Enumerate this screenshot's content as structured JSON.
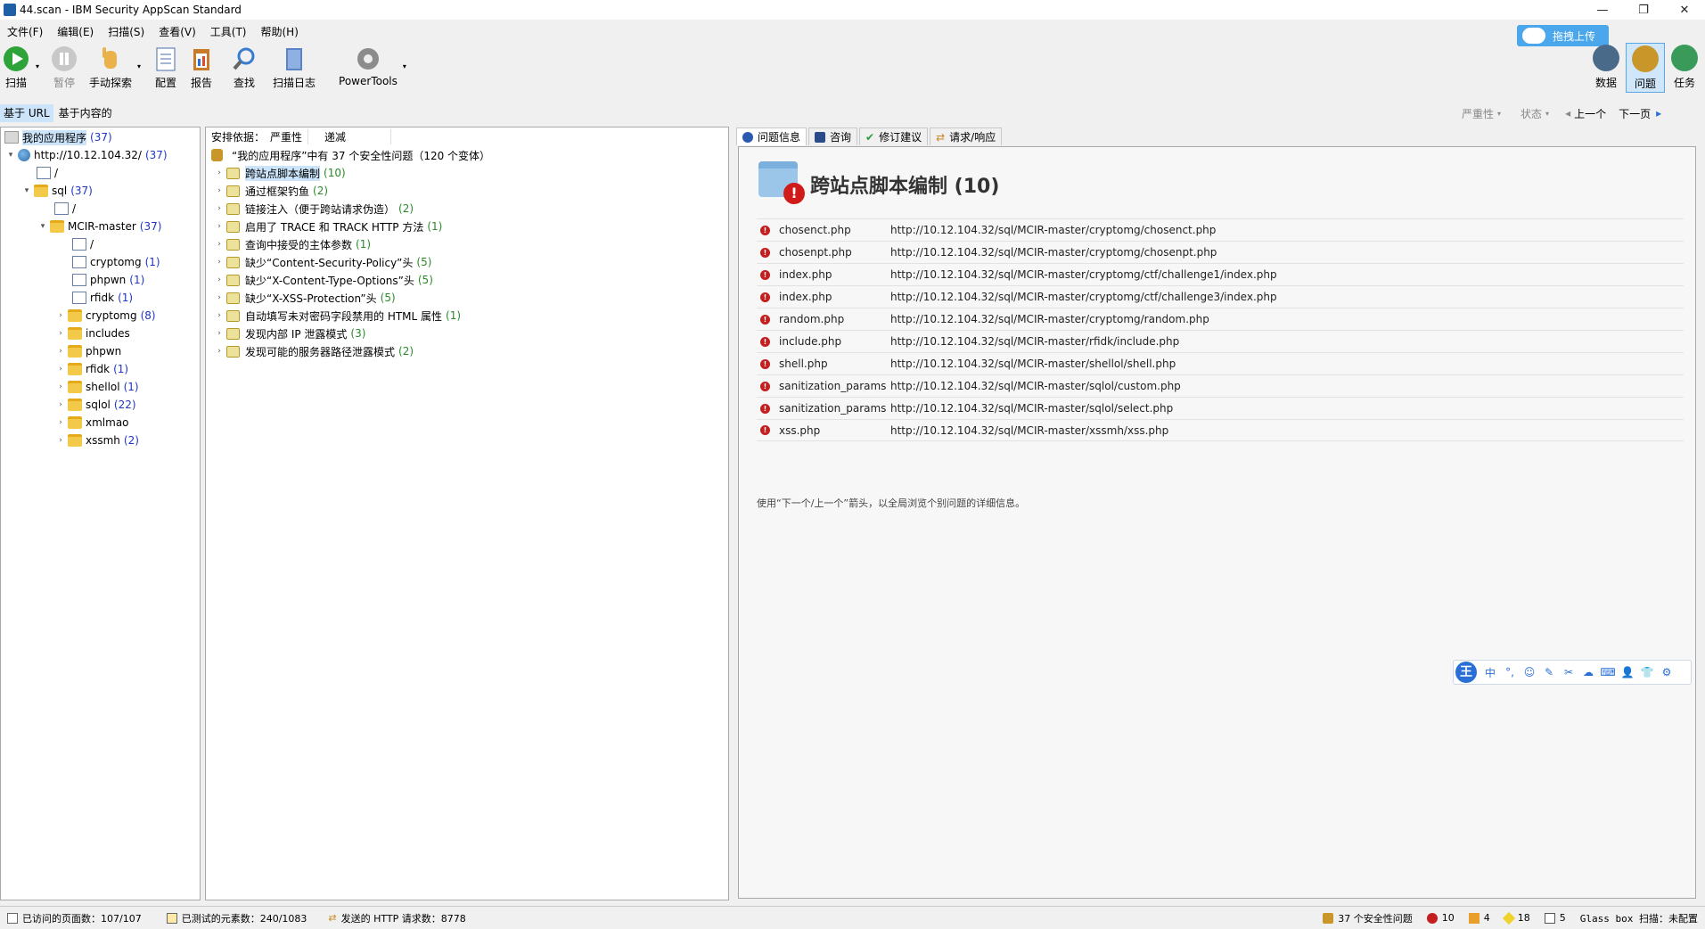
{
  "window": {
    "title": "44.scan - IBM Security AppScan Standard"
  },
  "menu": [
    "文件(F)",
    "编辑(E)",
    "扫描(S)",
    "查看(V)",
    "工具(T)",
    "帮助(H)"
  ],
  "upload": {
    "label": "拖拽上传"
  },
  "toolbar": {
    "scan": "扫描",
    "pause": "暂停",
    "manual": "手动探索",
    "config": "配置",
    "report": "报告",
    "find": "查找",
    "log": "扫描日志",
    "powertools": "PowerTools"
  },
  "toolbar_right": {
    "data": "数据",
    "issues": "问题",
    "tasks": "任务"
  },
  "view_tabs": {
    "by_url": "基于 URL",
    "by_content": "基于内容的"
  },
  "nav": {
    "severity": "严重性",
    "status": "状态",
    "prev": "上一个",
    "next": "下一页"
  },
  "tree": {
    "root": {
      "label": "我的应用程序",
      "count": "(37)"
    },
    "host": {
      "label": "http://10.12.104.32/",
      "count": "(37)"
    },
    "slash": "/",
    "sql": {
      "label": "sql",
      "count": "(37)"
    },
    "sql_slash": "/",
    "mcir": {
      "label": "MCIR-master",
      "count": "(37)"
    },
    "mcir_slash": "/",
    "cryptomg_page": {
      "label": "cryptomg",
      "count": "(1)"
    },
    "phpwn_page": {
      "label": "phpwn",
      "count": "(1)"
    },
    "rfidk_page": {
      "label": "rfidk",
      "count": "(1)"
    },
    "cryptomg": {
      "label": "cryptomg",
      "count": "(8)"
    },
    "includes": {
      "label": "includes"
    },
    "phpwn": {
      "label": "phpwn"
    },
    "rfidk": {
      "label": "rfidk",
      "count": "(1)"
    },
    "shellol": {
      "label": "shellol",
      "count": "(1)"
    },
    "sqlol": {
      "label": "sqlol",
      "count": "(22)"
    },
    "xmlmao": {
      "label": "xmlmao"
    },
    "xssmh": {
      "label": "xssmh",
      "count": "(2)"
    }
  },
  "mid": {
    "sort_label": "安排依据：",
    "sort_value": "严重性",
    "decrease": "递减",
    "summary": "“我的应用程序”中有 37 个安全性问题（120 个变体）",
    "issues": [
      {
        "label": "跨站点脚本编制",
        "count": "(10)"
      },
      {
        "label": "通过框架钓鱼",
        "count": "(2)"
      },
      {
        "label": "链接注入（便于跨站请求伪造）",
        "count": "(2)"
      },
      {
        "label": "启用了 TRACE 和 TRACK HTTP 方法",
        "count": "(1)"
      },
      {
        "label": "查询中接受的主体参数",
        "count": "(1)"
      },
      {
        "label": "缺少“Content-Security-Policy”头",
        "count": "(5)"
      },
      {
        "label": "缺少“X-Content-Type-Options”头",
        "count": "(5)"
      },
      {
        "label": "缺少“X-XSS-Protection”头",
        "count": "(5)"
      },
      {
        "label": "自动填写未对密码字段禁用的 HTML 属性",
        "count": "(1)"
      },
      {
        "label": "发现内部 IP 泄露模式",
        "count": "(3)"
      },
      {
        "label": "发现可能的服务器路径泄露模式",
        "count": "(2)"
      }
    ]
  },
  "right": {
    "tabs": [
      "问题信息",
      "咨询",
      "修订建议",
      "请求/响应"
    ],
    "title": "跨站点脚本编制 (10)",
    "rows": [
      {
        "file": "chosenct.php",
        "url": "http://10.12.104.32/sql/MCIR-master/cryptomg/chosenct.php"
      },
      {
        "file": "chosenpt.php",
        "url": "http://10.12.104.32/sql/MCIR-master/cryptomg/chosenpt.php"
      },
      {
        "file": "index.php",
        "url": "http://10.12.104.32/sql/MCIR-master/cryptomg/ctf/challenge1/index.php"
      },
      {
        "file": "index.php",
        "url": "http://10.12.104.32/sql/MCIR-master/cryptomg/ctf/challenge3/index.php"
      },
      {
        "file": "random.php",
        "url": "http://10.12.104.32/sql/MCIR-master/cryptomg/random.php"
      },
      {
        "file": "include.php",
        "url": "http://10.12.104.32/sql/MCIR-master/rfidk/include.php"
      },
      {
        "file": "shell.php",
        "url": "http://10.12.104.32/sql/MCIR-master/shellol/shell.php"
      },
      {
        "file": "sanitization_params",
        "url": "http://10.12.104.32/sql/MCIR-master/sqlol/custom.php"
      },
      {
        "file": "sanitization_params",
        "url": "http://10.12.104.32/sql/MCIR-master/sqlol/select.php"
      },
      {
        "file": "xss.php",
        "url": "http://10.12.104.32/sql/MCIR-master/xssmh/xss.php"
      }
    ],
    "hint": "使用“下一个/上一个”箭头，以全局浏览个别问题的详细信息。"
  },
  "ime": {
    "logo": "王",
    "items": [
      "中",
      "°,",
      "☺",
      "✎",
      "✂",
      "☁",
      "⌨",
      "👤",
      "👕",
      "⚙"
    ]
  },
  "status": {
    "visited": "已访问的页面数：107/107",
    "tested": "已测试的元素数：240/1083",
    "requests": "发送的 HTTP 请求数：8778",
    "issues": "37 个安全性问题",
    "high": "10",
    "medium": "4",
    "low": "18",
    "info": "5",
    "glassbox": "Glass box 扫描：未配置"
  },
  "colors": {
    "accent": "#1f35c8",
    "count_green": "#2a8a2a",
    "error_red": "#c41e1e",
    "selection": "#cce4fa"
  }
}
